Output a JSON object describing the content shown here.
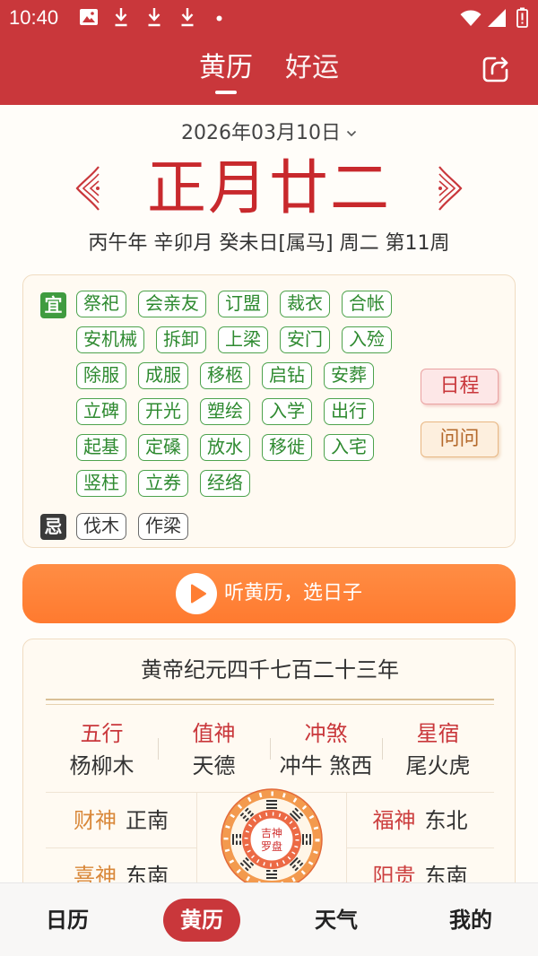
{
  "status_bar": {
    "time": "10:40",
    "notification_icons": [
      "image-icon",
      "download-icon",
      "download-icon",
      "download-icon",
      "dot-icon"
    ],
    "system_icons": [
      "wifi-icon",
      "signal-icon",
      "battery-icon"
    ]
  },
  "header": {
    "tabs": [
      {
        "label": "黄历",
        "active": true
      },
      {
        "label": "好运",
        "active": false
      }
    ],
    "share_icon": "share-icon"
  },
  "date_selector": {
    "date": "2026年03月10日",
    "icon": "chevron-down-icon"
  },
  "lunar": {
    "date": "正月廿二",
    "details": "丙午年 辛卯月 癸未日[属马] 周二 第11周"
  },
  "almanac": {
    "yi": {
      "badge": "宜",
      "rows": [
        [
          "祭祀",
          "会亲友",
          "订盟",
          "裁衣",
          "合帐"
        ],
        [
          "安机械",
          "拆卸",
          "上梁",
          "安门",
          "入殓"
        ],
        [
          "除服",
          "成服",
          "移柩",
          "启钻",
          "安葬"
        ],
        [
          "立碑",
          "开光",
          "塑绘",
          "入学",
          "出行"
        ],
        [
          "起基",
          "定磉",
          "放水",
          "移徙",
          "入宅"
        ],
        [
          "竖柱",
          "立券",
          "经络"
        ]
      ]
    },
    "ji": {
      "badge": "忌",
      "items": [
        "伐木",
        "作梁"
      ]
    },
    "actions": {
      "schedule": "日程",
      "ask": "问问"
    }
  },
  "listen_button": {
    "label": "听黄历，选日子",
    "icon": "play-icon"
  },
  "details": {
    "era": "黄帝纪元四千七百二十三年",
    "attributes": [
      {
        "label": "五行",
        "value": "杨柳木"
      },
      {
        "label": "值神",
        "value": "天德"
      },
      {
        "label": "冲煞",
        "value": "冲牛 煞西"
      },
      {
        "label": "星宿",
        "value": "尾火虎"
      }
    ],
    "gods_left": [
      {
        "label": "财神",
        "value": "正南"
      },
      {
        "label": "喜神",
        "value": "东南"
      }
    ],
    "gods_right": [
      {
        "label": "福神",
        "value": "东北"
      },
      {
        "label": "阳贵",
        "value": "东南"
      }
    ],
    "compass": {
      "title_line1": "吉神",
      "title_line2": "罗盘"
    }
  },
  "bottom_nav": {
    "items": [
      {
        "label": "日历",
        "active": false
      },
      {
        "label": "黄历",
        "active": true
      },
      {
        "label": "天气",
        "active": false
      },
      {
        "label": "我的",
        "active": false
      }
    ]
  },
  "colors": {
    "header_red": "#c9373b",
    "lunar_red": "#c8292d",
    "yi_green": "#3f9b40",
    "ji_dark": "#3a3a3a",
    "listen_orange": "#ff7e33",
    "god_orange": "#d9883a"
  }
}
